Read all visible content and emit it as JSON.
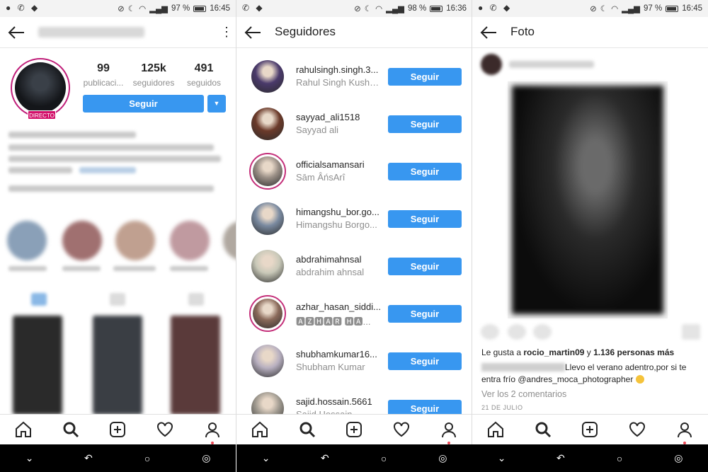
{
  "panel1": {
    "status": {
      "left_icons": "● ✆ ◆",
      "mute": "🔕",
      "moon": "☾",
      "signal": "▂▄▆",
      "battery_pct": "97 %",
      "time": "16:45"
    },
    "stats": [
      {
        "num": "99",
        "label": "publicaci..."
      },
      {
        "num": "125k",
        "label": "seguidores"
      },
      {
        "num": "491",
        "label": "seguidos"
      }
    ],
    "live_badge": "DIRECTO",
    "follow_button": "Seguir",
    "dropdown": "▼"
  },
  "panel2": {
    "status": {
      "left_icons": "✆ ◆",
      "battery_pct": "98 %",
      "time": "16:36"
    },
    "title": "Seguidores",
    "rows": [
      {
        "username": "rahulsingh.singh.3...",
        "fullname": "Rahul Singh Kushw...",
        "button": "Seguir",
        "color": "#4a3a6b",
        "ring": false
      },
      {
        "username": "sayyad_ali1518",
        "fullname": "Sayyad ali",
        "button": "Seguir",
        "color": "#6b3a2a",
        "ring": false
      },
      {
        "username": "officialsamansari",
        "fullname": "Sām ÂńsArî",
        "button": "Seguir",
        "color": "#9a8f86",
        "ring": true
      },
      {
        "username": "himangshu_bor.go...",
        "fullname": "Himangshu Borgo...",
        "button": "Seguir",
        "color": "#7a8aa0",
        "ring": false
      },
      {
        "username": "abdrahimahnsal",
        "fullname": "abdrahim ahnsal",
        "button": "Seguir",
        "color": "#c8c8b8",
        "ring": false
      },
      {
        "username": "azhar_hasan_siddi...",
        "fullname": "🅰🆉🅷🅰🆁 🅷🅰...",
        "button": "Seguir",
        "color": "#8a6a5a",
        "ring": true
      },
      {
        "username": "shubhamkumar16...",
        "fullname": "Shubham Kumar",
        "button": "Seguir",
        "color": "#b8b0c0",
        "ring": false
      },
      {
        "username": "sajid.hossain.5661",
        "fullname": "Sajid Hossain",
        "button": "Seguir",
        "color": "#a09a90",
        "ring": false
      }
    ]
  },
  "panel3": {
    "status": {
      "left_icons": "● ✆ ◆",
      "battery_pct": "97 %",
      "time": "16:45"
    },
    "title": "Foto",
    "likes_prefix": "Le gusta a",
    "likes_user": "rocio_martin09",
    "likes_and": "y",
    "likes_count": "1.136 personas más",
    "caption": "Llevo el verano adentro,por si te entra frío @andres_moca_photographer",
    "comments": "Ver los 2 comentarios",
    "date": "21 DE JULIO"
  },
  "bottom_nav": [
    "home-icon",
    "search-icon",
    "add-post-icon",
    "heart-icon",
    "profile-icon"
  ],
  "system_nav": {
    "hide": "⌄",
    "back": "↶",
    "home": "○",
    "recent": "◎"
  },
  "colors": {
    "accent": "#3897f0",
    "live": "#d2106a",
    "notif_dot": "#ed4956"
  }
}
